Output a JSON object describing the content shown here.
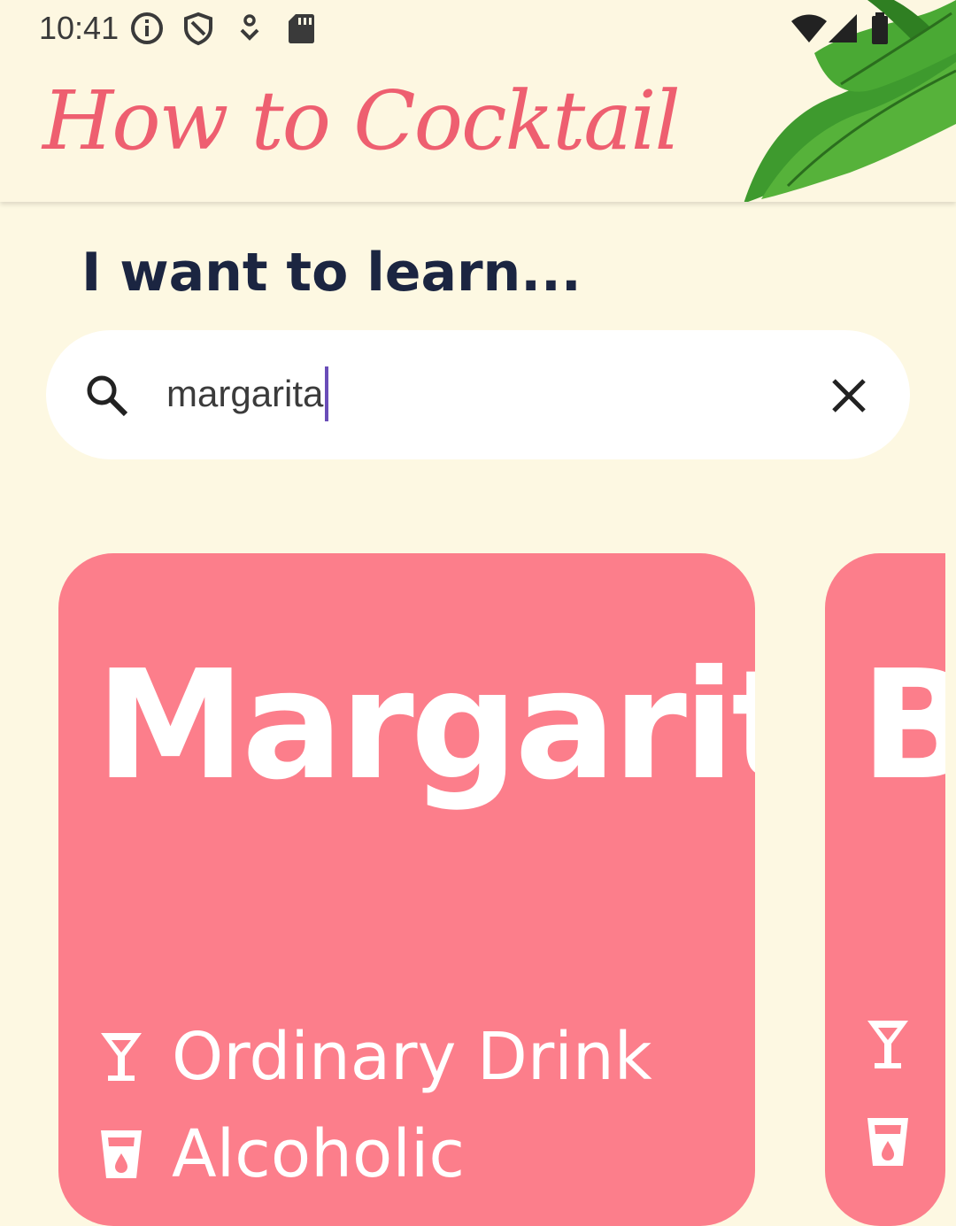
{
  "status_bar": {
    "time": "10:41",
    "left_icons": [
      "info-icon",
      "shield-icon",
      "download-icon",
      "sd-card-icon"
    ],
    "right_icons": [
      "wifi-icon",
      "signal-icon",
      "battery-icon"
    ]
  },
  "app_bar": {
    "title": "How to Cocktail",
    "decoration": "mint-leaves"
  },
  "main": {
    "heading": "I want to learn...",
    "search": {
      "value": "margarita",
      "icon": "search-icon",
      "clear_icon": "close-icon"
    },
    "cards": [
      {
        "title": "Margarita",
        "category": "Ordinary Drink",
        "alcoholic": "Alcoholic"
      },
      {
        "title": "Ba",
        "category": "",
        "alcoholic": ""
      }
    ]
  },
  "colors": {
    "background": "#FDF8E2",
    "accent": "#EE5F70",
    "card": "#FC7E8B",
    "heading": "#1B2541",
    "caret": "#6A4DB8"
  }
}
